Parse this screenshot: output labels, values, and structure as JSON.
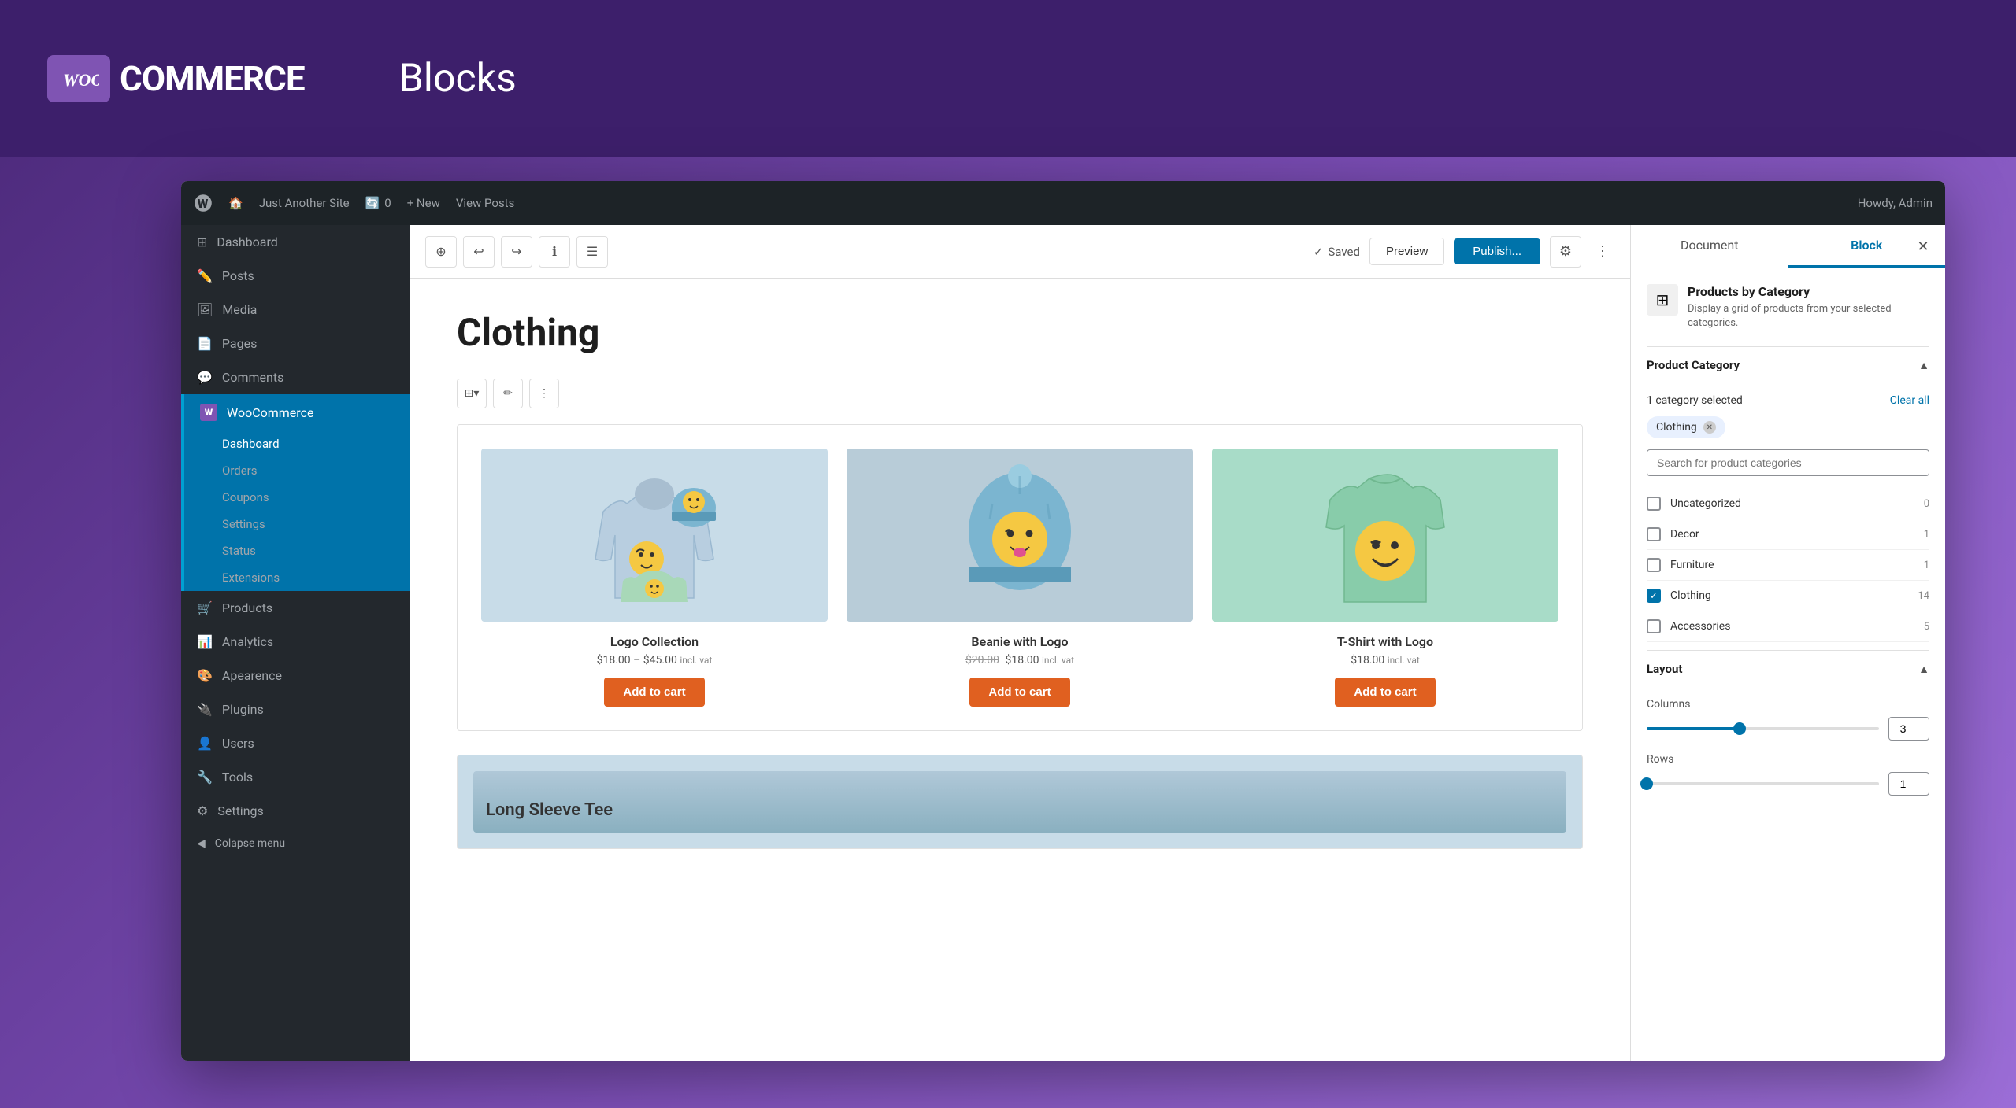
{
  "header": {
    "logo_text": "COMMERCE",
    "page_title": "Blocks"
  },
  "admin_bar": {
    "site_name": "Just Another Site",
    "updates_count": "0",
    "new_label": "+ New",
    "view_posts": "View Posts",
    "howdy": "Howdy, Admin"
  },
  "sidebar": {
    "items": [
      {
        "id": "dashboard",
        "label": "Dashboard",
        "icon": "⊞"
      },
      {
        "id": "posts",
        "label": "Posts",
        "icon": "📝"
      },
      {
        "id": "media",
        "label": "Media",
        "icon": "🖼"
      },
      {
        "id": "pages",
        "label": "Pages",
        "icon": "📄"
      },
      {
        "id": "comments",
        "label": "Comments",
        "icon": "💬"
      },
      {
        "id": "woocommerce",
        "label": "WooCommerce",
        "icon": "W",
        "active": true
      }
    ],
    "woo_subitems": [
      {
        "id": "woo-dashboard",
        "label": "Dashboard",
        "active": true
      },
      {
        "id": "orders",
        "label": "Orders"
      },
      {
        "id": "coupons",
        "label": "Coupons"
      },
      {
        "id": "settings",
        "label": "Settings"
      },
      {
        "id": "status",
        "label": "Status"
      },
      {
        "id": "extensions",
        "label": "Extensions"
      }
    ],
    "bottom_items": [
      {
        "id": "products",
        "label": "Products",
        "icon": "🛒"
      },
      {
        "id": "analytics",
        "label": "Analytics",
        "icon": "📊"
      },
      {
        "id": "appearance",
        "label": "Apearence",
        "icon": "🎨"
      },
      {
        "id": "plugins",
        "label": "Plugins",
        "icon": "🔌"
      },
      {
        "id": "users",
        "label": "Users",
        "icon": "👤"
      },
      {
        "id": "tools",
        "label": "Tools",
        "icon": "🔧"
      },
      {
        "id": "settings2",
        "label": "Settings",
        "icon": "⚙"
      }
    ],
    "collapse": "Colapse menu"
  },
  "editor": {
    "saved_label": "Saved",
    "preview_btn": "Preview",
    "publish_btn": "Publish...",
    "block_heading": "Clothing",
    "second_product_label": "Long Sleeve Tee"
  },
  "products": [
    {
      "id": "logo-collection",
      "name": "Logo Collection",
      "price_original": "",
      "price": "$18.00 – $45.00",
      "incl_vat": "incl. vat",
      "add_to_cart": "Add to cart",
      "bg_color": "#c8dce8",
      "type": "hoodie"
    },
    {
      "id": "beanie-with-logo",
      "name": "Beanie with Logo",
      "price_original": "$20.00",
      "price": "$18.00",
      "incl_vat": "incl. vat",
      "add_to_cart": "Add to cart",
      "bg_color": "#b8ccd8",
      "type": "beanie"
    },
    {
      "id": "tshirt-with-logo",
      "name": "T-Shirt with Logo",
      "price_original": "",
      "price": "$18.00",
      "incl_vat": "incl. vat",
      "add_to_cart": "Add to cart",
      "bg_color": "#a8dcc8",
      "type": "tshirt"
    }
  ],
  "right_sidebar": {
    "tabs": [
      "Document",
      "Block"
    ],
    "active_tab": "Block",
    "block_name": "Products by Category",
    "block_desc": "Display a grid of products from your selected categories.",
    "product_category_section": "Product Category",
    "selected_count": "1 category selected",
    "clear_all": "Clear all",
    "selected_tag": "Clothing",
    "search_placeholder": "Search for product categories",
    "categories": [
      {
        "id": "uncategorized",
        "label": "Uncategorized",
        "count": 0,
        "checked": false
      },
      {
        "id": "decor",
        "label": "Decor",
        "count": 1,
        "checked": false
      },
      {
        "id": "furniture",
        "label": "Furniture",
        "count": 1,
        "checked": false
      },
      {
        "id": "clothing",
        "label": "Clothing",
        "count": 14,
        "checked": true
      },
      {
        "id": "accessories",
        "label": "Accessories",
        "count": 5,
        "checked": false
      }
    ],
    "layout_section": "Layout",
    "columns_label": "Columns",
    "columns_value": "3",
    "columns_min": 1,
    "columns_max": 6,
    "columns_fill_pct": "40",
    "rows_label": "Rows",
    "rows_value": "1",
    "rows_fill_pct": "0"
  }
}
